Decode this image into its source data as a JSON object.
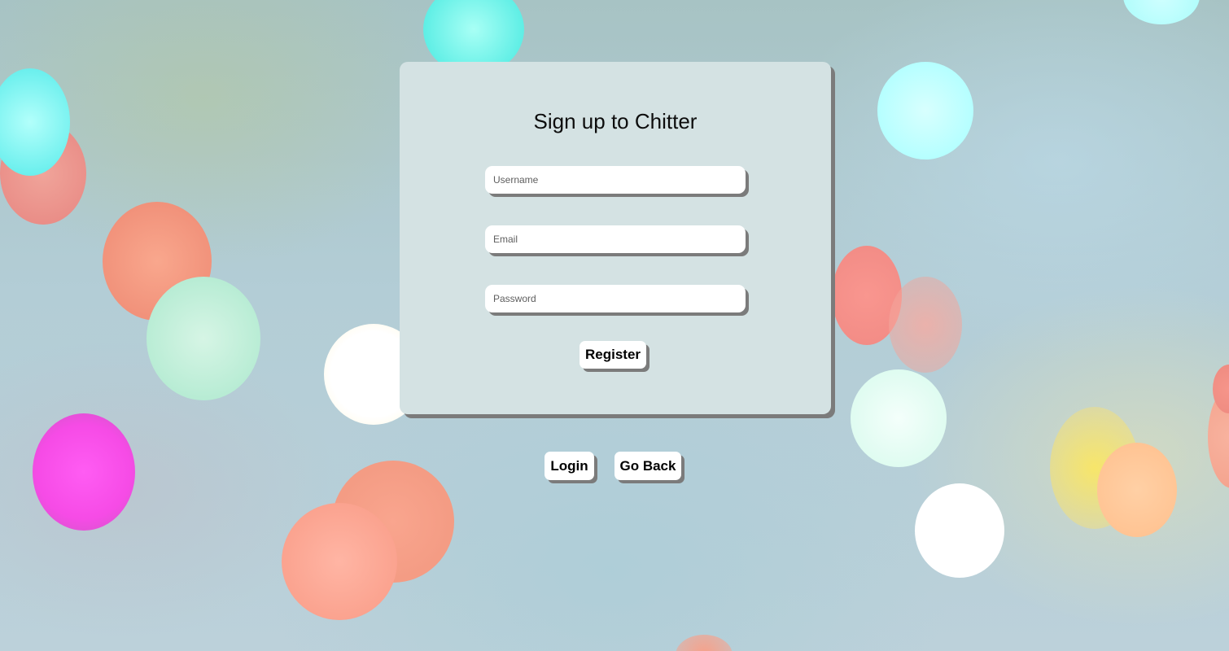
{
  "signup": {
    "title": "Sign up to Chitter",
    "username_placeholder": "Username",
    "email_placeholder": "Email",
    "password_placeholder": "Password",
    "register_label": "Register"
  },
  "nav": {
    "login_label": "Login",
    "go_back_label": "Go Back"
  },
  "colors": {
    "card_background": "#d4e2e3",
    "shadow": "#7b7b7b",
    "button_background": "#ffffff"
  }
}
